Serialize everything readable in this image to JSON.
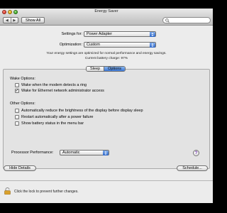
{
  "window": {
    "title": "Energy Saver"
  },
  "toolbar": {
    "back_glyph": "◀",
    "forward_glyph": "▶",
    "show_all_label": "Show All",
    "search_value": ""
  },
  "settings_for": {
    "label": "Settings for:",
    "value": "Power Adapter"
  },
  "optimization": {
    "label": "Optimization:",
    "value": "Custom"
  },
  "info": {
    "line1": "Your energy settings are optimized for normal performance and energy savings.",
    "line2": "Current battery charge: 97%"
  },
  "tabs": [
    {
      "label": "Sleep",
      "selected": false
    },
    {
      "label": "Options",
      "selected": true
    }
  ],
  "wake_options": {
    "title": "Wake Options:",
    "items": [
      {
        "label": "Wake when the modem detects a ring",
        "checked": false
      },
      {
        "label": "Wake for Ethernet network administrator access",
        "checked": true
      }
    ]
  },
  "other_options": {
    "title": "Other Options:",
    "items": [
      {
        "label": "Automatically reduce the brightness of the display before display sleep",
        "checked": false
      },
      {
        "label": "Restart automatically after a power failure",
        "checked": false
      },
      {
        "label": "Show battery status in the menu bar",
        "checked": false
      }
    ]
  },
  "processor_performance": {
    "label": "Processor Performance:",
    "value": "Automatic"
  },
  "help_glyph": "?",
  "buttons": {
    "hide_details": "Hide Details",
    "schedule": "Schedule..."
  },
  "footer": {
    "lock_text": "Click the lock to prevent further changes."
  },
  "colors": {
    "accent": "#3a75d4",
    "window_bg": "#ececec",
    "panel_bg": "#e3e3e3"
  },
  "icons": [
    "close-icon",
    "minimize-icon",
    "zoom-icon",
    "back-arrow-icon",
    "forward-arrow-icon",
    "search-icon",
    "popup-arrows-icon",
    "help-icon",
    "lock-icon"
  ]
}
